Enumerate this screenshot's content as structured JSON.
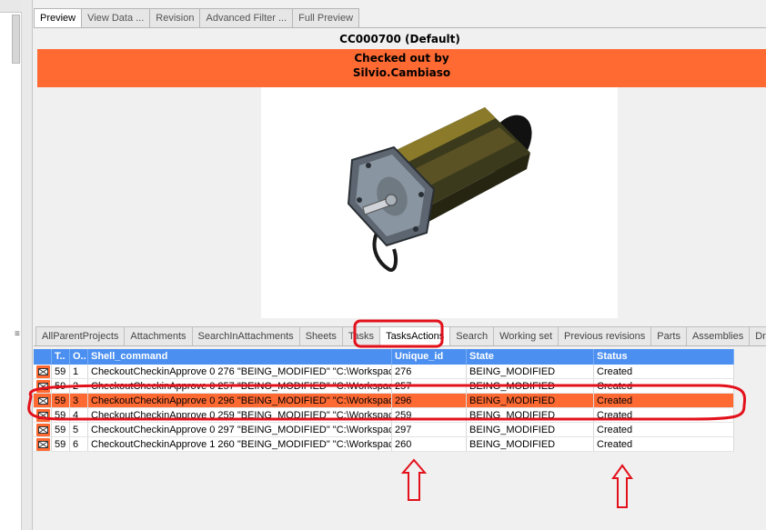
{
  "top_tabs": [
    "Preview",
    "View Data ...",
    "Revision",
    "Advanced Filter ...",
    "Full Preview"
  ],
  "title": "CC000700 (Default)",
  "banner": {
    "line1": "Checked out by",
    "line2": "Silvio.Cambiaso"
  },
  "bottom_tabs": [
    "AllParentProjects",
    "Attachments",
    "SearchInAttachments",
    "Sheets",
    "Tasks",
    "TasksActions",
    "Search",
    "Working set",
    "Previous revisions",
    "Parts",
    "Assemblies",
    "Drawings"
  ],
  "grid": {
    "headers": [
      "T..",
      "O..",
      "Shell_command",
      "Unique_id",
      "State",
      "Status"
    ],
    "rows": [
      {
        "t": "59",
        "o": "1",
        "cmd": "CheckoutCheckinApprove 0 276 \"BEING_MODIFIED\" \"C:\\Workspac...",
        "uid": "276",
        "state": "BEING_MODIFIED",
        "status": "Created"
      },
      {
        "t": "59",
        "o": "2",
        "cmd": "CheckoutCheckinApprove 0 257 \"BEING_MODIFIED\" \"C:\\Workspac...",
        "uid": "257",
        "state": "BEING_MODIFIED",
        "status": "Created"
      },
      {
        "t": "59",
        "o": "3",
        "cmd": "CheckoutCheckinApprove 0 296 \"BEING_MODIFIED\" \"C:\\Workspac...",
        "uid": "296",
        "state": "BEING_MODIFIED",
        "status": "Created"
      },
      {
        "t": "59",
        "o": "4",
        "cmd": "CheckoutCheckinApprove 0 259 \"BEING_MODIFIED\" \"C:\\Workspac...",
        "uid": "259",
        "state": "BEING_MODIFIED",
        "status": "Created"
      },
      {
        "t": "59",
        "o": "5",
        "cmd": "CheckoutCheckinApprove 0 297 \"BEING_MODIFIED\" \"C:\\Workspac...",
        "uid": "297",
        "state": "BEING_MODIFIED",
        "status": "Created"
      },
      {
        "t": "59",
        "o": "6",
        "cmd": "CheckoutCheckinApprove 1 260 \"BEING_MODIFIED\" \"C:\\Workspac...",
        "uid": "260",
        "state": "BEING_MODIFIED",
        "status": "Created"
      }
    ],
    "selected_row": 2
  },
  "colors": {
    "accent_orange": "#ff6a33",
    "header_blue": "#4b8ff0",
    "annotation_red": "#e3111b"
  },
  "icons": {
    "row_icon": "envelope-x-icon",
    "grip": "splitter-grip-icon"
  }
}
